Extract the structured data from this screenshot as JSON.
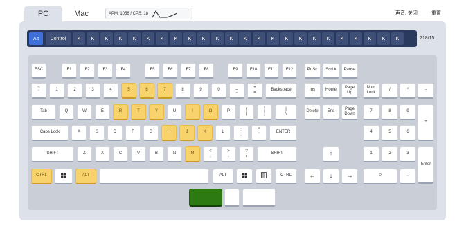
{
  "tabs": {
    "pc": "PC",
    "mac": "Mac"
  },
  "speed": {
    "label": "APM: 1056 / CPS: 18"
  },
  "header": {
    "sound": "声音: 关闭",
    "reset": "重置"
  },
  "sequence": {
    "keys": [
      "Alt",
      "Control",
      "K",
      "K",
      "K",
      "K",
      "K",
      "K",
      "K",
      "K",
      "K",
      "K",
      "K",
      "K",
      "K",
      "K",
      "K",
      "K",
      "K",
      "K",
      "K",
      "K",
      "K",
      "K",
      "K",
      "K"
    ],
    "counter": "218/15"
  },
  "keys": {
    "esc": "ESC",
    "f1": "F1",
    "f2": "F2",
    "f3": "F3",
    "f4": "F4",
    "f5": "F5",
    "f6": "F6",
    "f7": "F7",
    "f8": "F8",
    "f9": "F9",
    "f10": "F10",
    "f11": "F11",
    "f12": "F12",
    "prtsc": "PrtSc",
    "scrlk": "ScrLk",
    "pause": "Pause",
    "backtick_top": "~",
    "backtick_bottom": "`",
    "n1": "1",
    "n2": "2",
    "n3": "3",
    "n4": "4",
    "n5": "5",
    "n6": "6",
    "n7": "7",
    "n8": "8",
    "n9": "9",
    "n0": "0",
    "minus_top": "_",
    "minus_bottom": "-",
    "equal_top": "+",
    "equal_bottom": "=",
    "backspace": "Backspace",
    "ins": "Ins",
    "home": "Home",
    "pgup1": "Page",
    "pgup2": "Up",
    "numlock1": "Num",
    "numlock2": "Lock",
    "np_div": "/",
    "np_mul": "*",
    "np_minus": "-",
    "tab": "Tab",
    "q": "Q",
    "w": "W",
    "e": "E",
    "r": "R",
    "t": "T",
    "y": "Y",
    "u": "U",
    "i": "I",
    "o": "O",
    "p": "P",
    "lbr_top": "{",
    "lbr_bottom": "[",
    "rbr_top": "}",
    "rbr_bottom": "]",
    "bsl_top": "|",
    "bsl_bottom": "\\",
    "del": "Delete",
    "end": "End",
    "pgdn1": "Page",
    "pgdn2": "Down",
    "np7": "7",
    "np8": "8",
    "np9": "9",
    "np_plus": "+",
    "caps": "Caps Lock",
    "a": "A",
    "s": "S",
    "d": "D",
    "f": "F",
    "g": "G",
    "h": "H",
    "j": "J",
    "k": "K",
    "l": "L",
    "semi_top": ":",
    "semi_bottom": ";",
    "quote_top": "\"",
    "quote_bottom": "'",
    "enter": "ENTER",
    "np4": "4",
    "np5": "5",
    "np6": "6",
    "lshift": "SHIFT",
    "z": "Z",
    "x": "X",
    "c": "C",
    "v": "V",
    "b": "B",
    "n": "N",
    "m": "M",
    "comma_top": "<",
    "comma_bottom": ",",
    "period_top": ">",
    "period_bottom": ".",
    "slash_top": "?",
    "slash_bottom": "/",
    "rshift": "SHIFT",
    "up": "↑",
    "np1": "1",
    "np2": "2",
    "np3": "3",
    "np_enter": "Enter",
    "lctrl": "CTRL",
    "lalt": "ALT",
    "ralt": "ALT",
    "rctrl": "CTRL",
    "left": "←",
    "down": "↓",
    "right": "→",
    "np0": "0",
    "np_dot": "."
  },
  "colors": {
    "highlight": "#f8d26b",
    "sequence_bar": "#2a3a5f",
    "sequence_active": "#3f6fd8",
    "board": "#c9ced7",
    "green_key": "#2e7a12"
  }
}
